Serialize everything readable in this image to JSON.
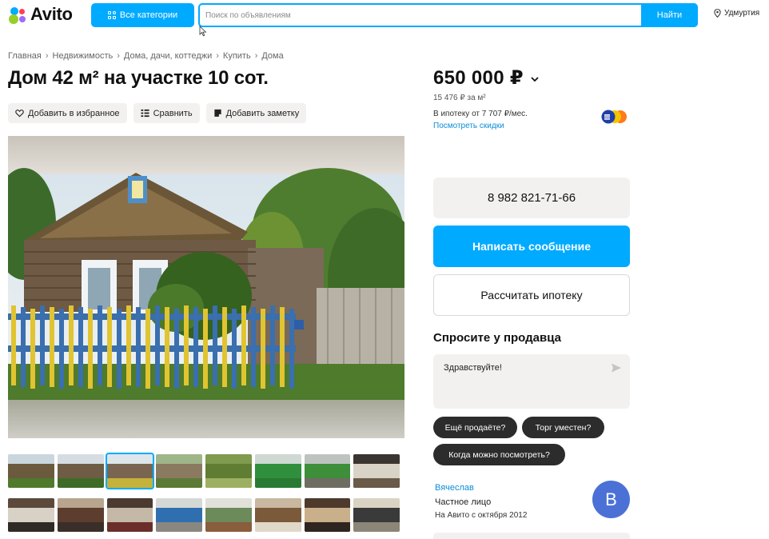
{
  "header": {
    "logo_text": "Avito",
    "categories_label": "Все категории",
    "search_placeholder": "Поиск по объявлениям",
    "search_button": "Найти",
    "location": "Удмуртия"
  },
  "breadcrumb": [
    "Главная",
    "Недвижимость",
    "Дома, дачи, коттеджи",
    "Купить",
    "Дома"
  ],
  "listing": {
    "title": "Дом 42 м² на участке 10 сот.",
    "actions": {
      "favorite": "Добавить в избранное",
      "compare": "Сравнить",
      "note": "Добавить заметку"
    },
    "thumbnail_count": 16,
    "active_thumbnail_index": 2
  },
  "price": {
    "value": "650 000 ₽",
    "per_m2": "15 476 ₽ за м²",
    "mortgage": "В ипотеку от 7 707 ₽/мес.",
    "discounts_link": "Посмотреть скидки"
  },
  "contact": {
    "phone": "8 982 821-71-66",
    "message_button": "Написать сообщение",
    "mortgage_button": "Рассчитать ипотеку"
  },
  "ask": {
    "title": "Спросите у продавца",
    "message": "Здравствуйте!",
    "chips": [
      "Ещё продаёте?",
      "Торг уместен?",
      "Когда можно посмотреть?"
    ]
  },
  "seller": {
    "name": "Вячеслав",
    "type": "Частное лицо",
    "since": "На Авито с октября 2012",
    "avatar_letter": "В"
  },
  "colors": {
    "accent": "#00aaff",
    "link": "#0a8dd8",
    "avatar": "#4c71d6",
    "chip": "#2c2c2c"
  }
}
